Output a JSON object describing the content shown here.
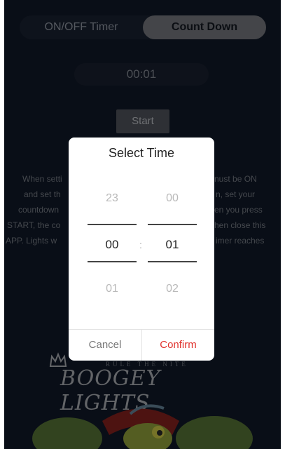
{
  "tabs": {
    "left": "ON/OFF Timer",
    "right": "Count Down"
  },
  "timer": {
    "display": "00:01"
  },
  "start_label": "Start",
  "instructions": [
    "When setti",
    "nust be ON",
    "and set th",
    "n, set your",
    "countdown",
    "en you press",
    "START, the co",
    "hen close this",
    "APP. Lights w",
    "imer reaches"
  ],
  "logo": {
    "tagline": "RULE THE NITE",
    "brand": "BOOGEY LIGHTS"
  },
  "dialog": {
    "title": "Select Time",
    "hours": {
      "prev": "23",
      "selected": "00",
      "next": "01"
    },
    "minutes": {
      "prev": "00",
      "selected": "01",
      "next": "02"
    },
    "separator": ":",
    "cancel": "Cancel",
    "confirm": "Confirm"
  },
  "colors": {
    "background": "#121a2a",
    "accent": "#e0312c"
  }
}
